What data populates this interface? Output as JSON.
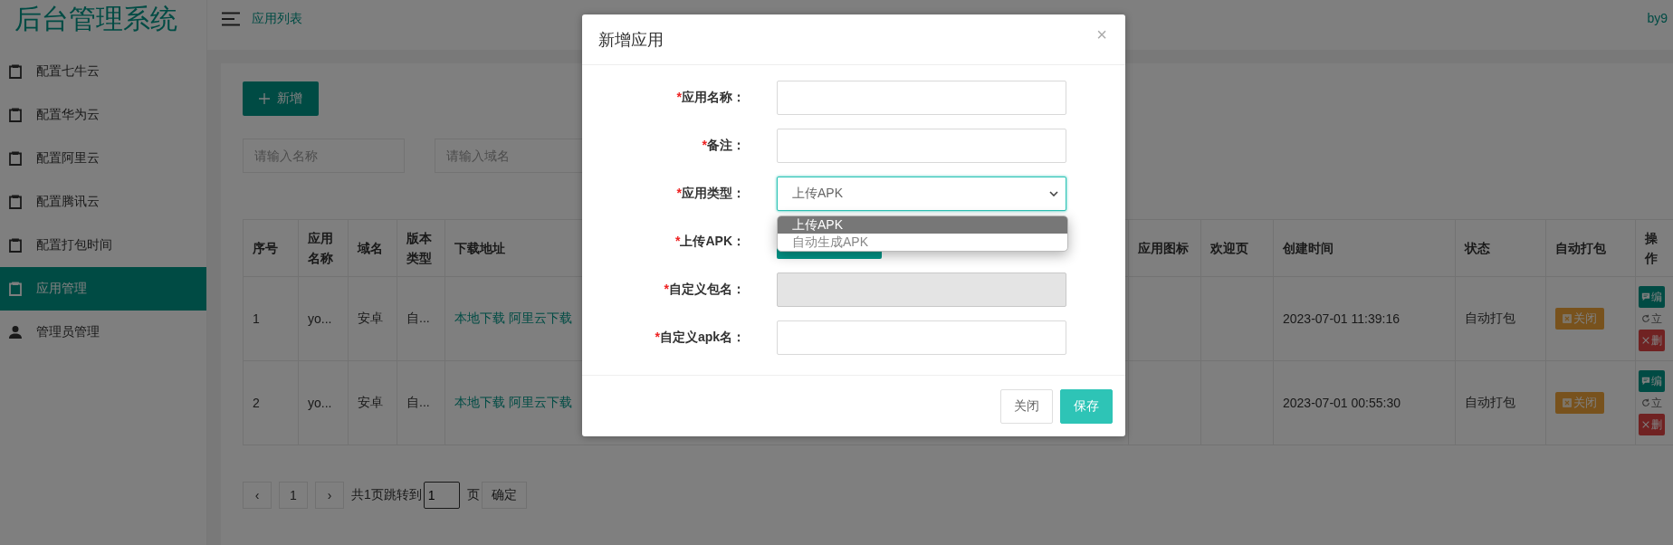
{
  "app": {
    "logo": "后台管理系统",
    "header_title": "应用列表",
    "user": "by9"
  },
  "sidebar": {
    "items": [
      {
        "label": "配置七牛云",
        "selected": false
      },
      {
        "label": "配置华为云",
        "selected": false
      },
      {
        "label": "配置阿里云",
        "selected": false
      },
      {
        "label": "配置腾讯云",
        "selected": false
      },
      {
        "label": "配置打包时间",
        "selected": false
      },
      {
        "label": "应用管理",
        "selected": true
      },
      {
        "label": "管理员管理",
        "selected": false
      }
    ]
  },
  "toolbar": {
    "add_button": "新增"
  },
  "filters": [
    {
      "placeholder": "请输入名称"
    },
    {
      "placeholder": "请输入域名"
    }
  ],
  "table": {
    "columns": [
      "序号",
      "应用名称",
      "域名",
      "版本类型",
      "下载地址",
      "应用图标",
      "欢迎页",
      "创建时间",
      "状态",
      "自动打包",
      "操作"
    ],
    "rows": [
      {
        "index": "1",
        "name": "yo...",
        "domain": "安卓",
        "type": "自...",
        "links": [
          "本地下载",
          "阿里云下载"
        ],
        "created": "2023-07-01 11:39:16",
        "status": "自动打包",
        "auto_pack": "关闭",
        "actions": [
          {
            "kind": "edit",
            "label": "编"
          },
          {
            "kind": "pack",
            "label": "立"
          },
          {
            "kind": "delete",
            "label": "删"
          }
        ]
      },
      {
        "index": "2",
        "name": "yo...",
        "domain": "安卓",
        "type": "自...",
        "links": [
          "本地下载",
          "阿里云下载"
        ],
        "created": "2023-07-01 00:55:30",
        "status": "自动打包",
        "auto_pack": "关闭",
        "actions": [
          {
            "kind": "edit",
            "label": "编"
          },
          {
            "kind": "pack",
            "label": "立"
          },
          {
            "kind": "delete",
            "label": "删"
          }
        ]
      }
    ]
  },
  "pagination": {
    "prev": "‹",
    "page": "1",
    "next": "›",
    "total_text": "共1页跳转到",
    "jump_value": "1",
    "page_unit": "页",
    "confirm": "确定"
  },
  "dialog": {
    "title": "新增应用",
    "close": "×",
    "fields": [
      {
        "mark": "*",
        "label": "应用名称：",
        "kind": "text",
        "disabled": false,
        "focused": false
      },
      {
        "mark": "*",
        "label": "备注：",
        "kind": "text",
        "disabled": false,
        "focused": false
      },
      {
        "mark": "*",
        "label": "应用类型：",
        "kind": "select",
        "value": "上传APK",
        "disabled": false,
        "focused": true
      },
      {
        "mark": "*",
        "label": "上传APK：",
        "kind": "upload",
        "disabled": false,
        "focused": false
      },
      {
        "mark": "*",
        "label": "自定义包名：",
        "kind": "text",
        "disabled": true,
        "focused": false
      },
      {
        "mark": "*",
        "label": "自定义apk名：",
        "kind": "text",
        "disabled": false,
        "focused": false
      }
    ],
    "options": [
      {
        "label": "上传APK",
        "selected": true
      },
      {
        "label": "自动生成APK",
        "selected": false
      }
    ],
    "buttons": [
      {
        "label": "关闭",
        "kind": "secondary"
      },
      {
        "label": "保存",
        "kind": "primary"
      }
    ]
  }
}
